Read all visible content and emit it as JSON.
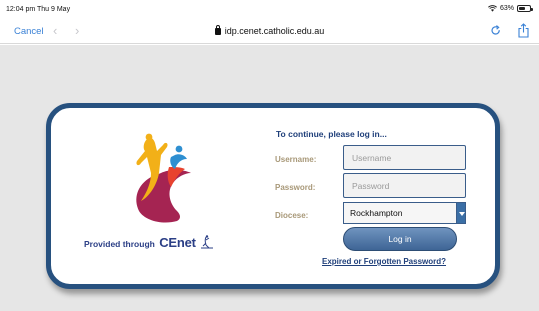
{
  "status_bar": {
    "time_date": "12:04 pm  Thu 9 May",
    "battery_percent": "63%",
    "battery_level": 0.63
  },
  "nav": {
    "cancel_label": "Cancel",
    "url": "idp.cenet.catholic.edu.au",
    "icons": [
      "back-chevron-icon",
      "forward-chevron-icon",
      "lock-icon",
      "reload-icon",
      "share-icon"
    ]
  },
  "branding": {
    "provided_text": "Provided through",
    "cenet_text": "CEnet"
  },
  "form": {
    "title": "To continue, please log in...",
    "username_label": "Username:",
    "username_placeholder": "Username",
    "password_label": "Password:",
    "password_placeholder": "Password",
    "diocese_label": "Diocese:",
    "diocese_value": "Rockhampton",
    "login_label": "Log in",
    "forgot_label": "Expired or Forgotten Password?"
  },
  "colors": {
    "accent_link": "#3b82d6",
    "card_border": "#27517f",
    "heading": "#1f3f7a",
    "label": "#a89878"
  }
}
